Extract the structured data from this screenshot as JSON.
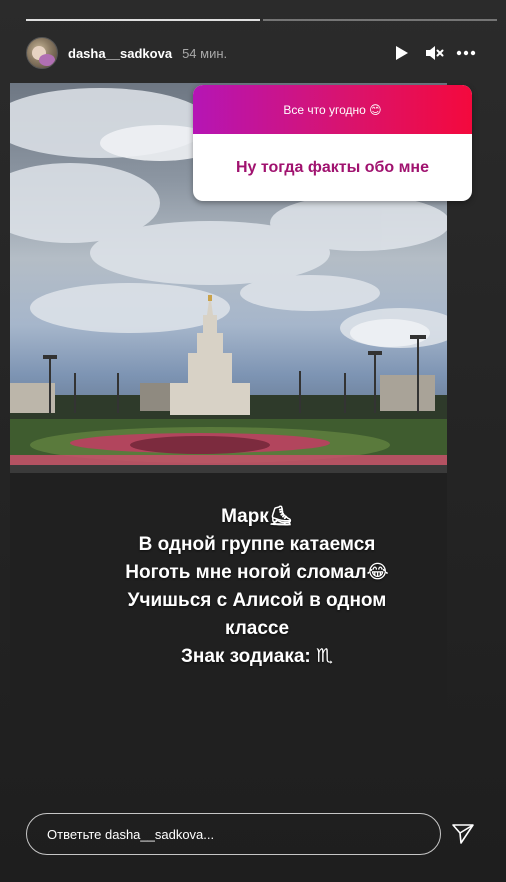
{
  "story": {
    "username": "dasha__sadkova",
    "time": "54 мин.",
    "progress_segments": 2,
    "progress_active": 1
  },
  "question_sticker": {
    "prompt": "Все что угодно 😊",
    "answer": "Ну тогда факты обо мне"
  },
  "caption": {
    "lines": [
      "Марк⛸",
      "В одной группе катаемся",
      "Ноготь мне ногой сломал😂",
      "Учишься с Алисой в одном",
      "классе",
      "Знак зодиака: ♏"
    ]
  },
  "reply": {
    "placeholder": "Ответьте dasha__sadkova..."
  },
  "icons": {
    "play": "play-icon",
    "mute": "mute-icon",
    "more": "more-icon",
    "send": "send-icon"
  }
}
